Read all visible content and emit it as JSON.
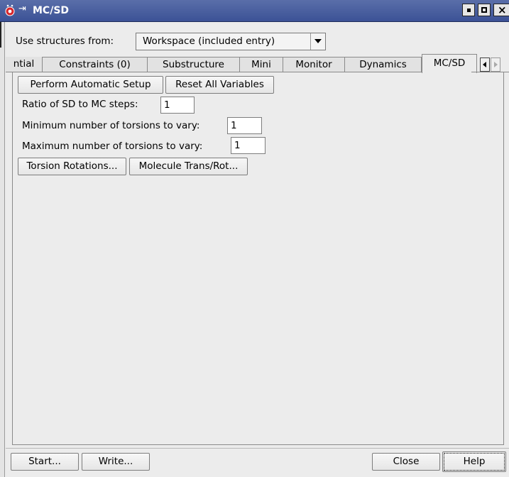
{
  "window": {
    "title": "MC/SD",
    "pin_glyph": "⇥",
    "icons": [
      "app-icon",
      "pin-icon",
      "minimize-icon",
      "maximize-icon",
      "close-icon"
    ]
  },
  "structures": {
    "label": "Use structures from:",
    "selected": "Workspace (included entry)"
  },
  "tabs": [
    "ntial",
    "Constraints (0)",
    "Substructure",
    "Mini",
    "Monitor",
    "Dynamics",
    "MC/SD"
  ],
  "active_tab": "MC/SD",
  "panel": {
    "perform_setup_label": "Perform Automatic Setup",
    "reset_vars_label": "Reset All Variables",
    "ratio_label": "Ratio of SD to MC steps:",
    "ratio_value": "1",
    "min_torsions_label": "Minimum number of torsions to vary:",
    "min_torsions_value": "1",
    "max_torsions_label": "Maximum number of torsions to vary:",
    "max_torsions_value": "1",
    "torsion_rotations_label": "Torsion Rotations...",
    "molecule_transrot_label": "Molecule Trans/Rot..."
  },
  "footer": {
    "start_label": "Start...",
    "write_label": "Write...",
    "close_label": "Close",
    "help_label": "Help"
  },
  "colors": {
    "titlebar": "#3c5296",
    "background": "#ececec",
    "app_icon": "#d7262d"
  }
}
